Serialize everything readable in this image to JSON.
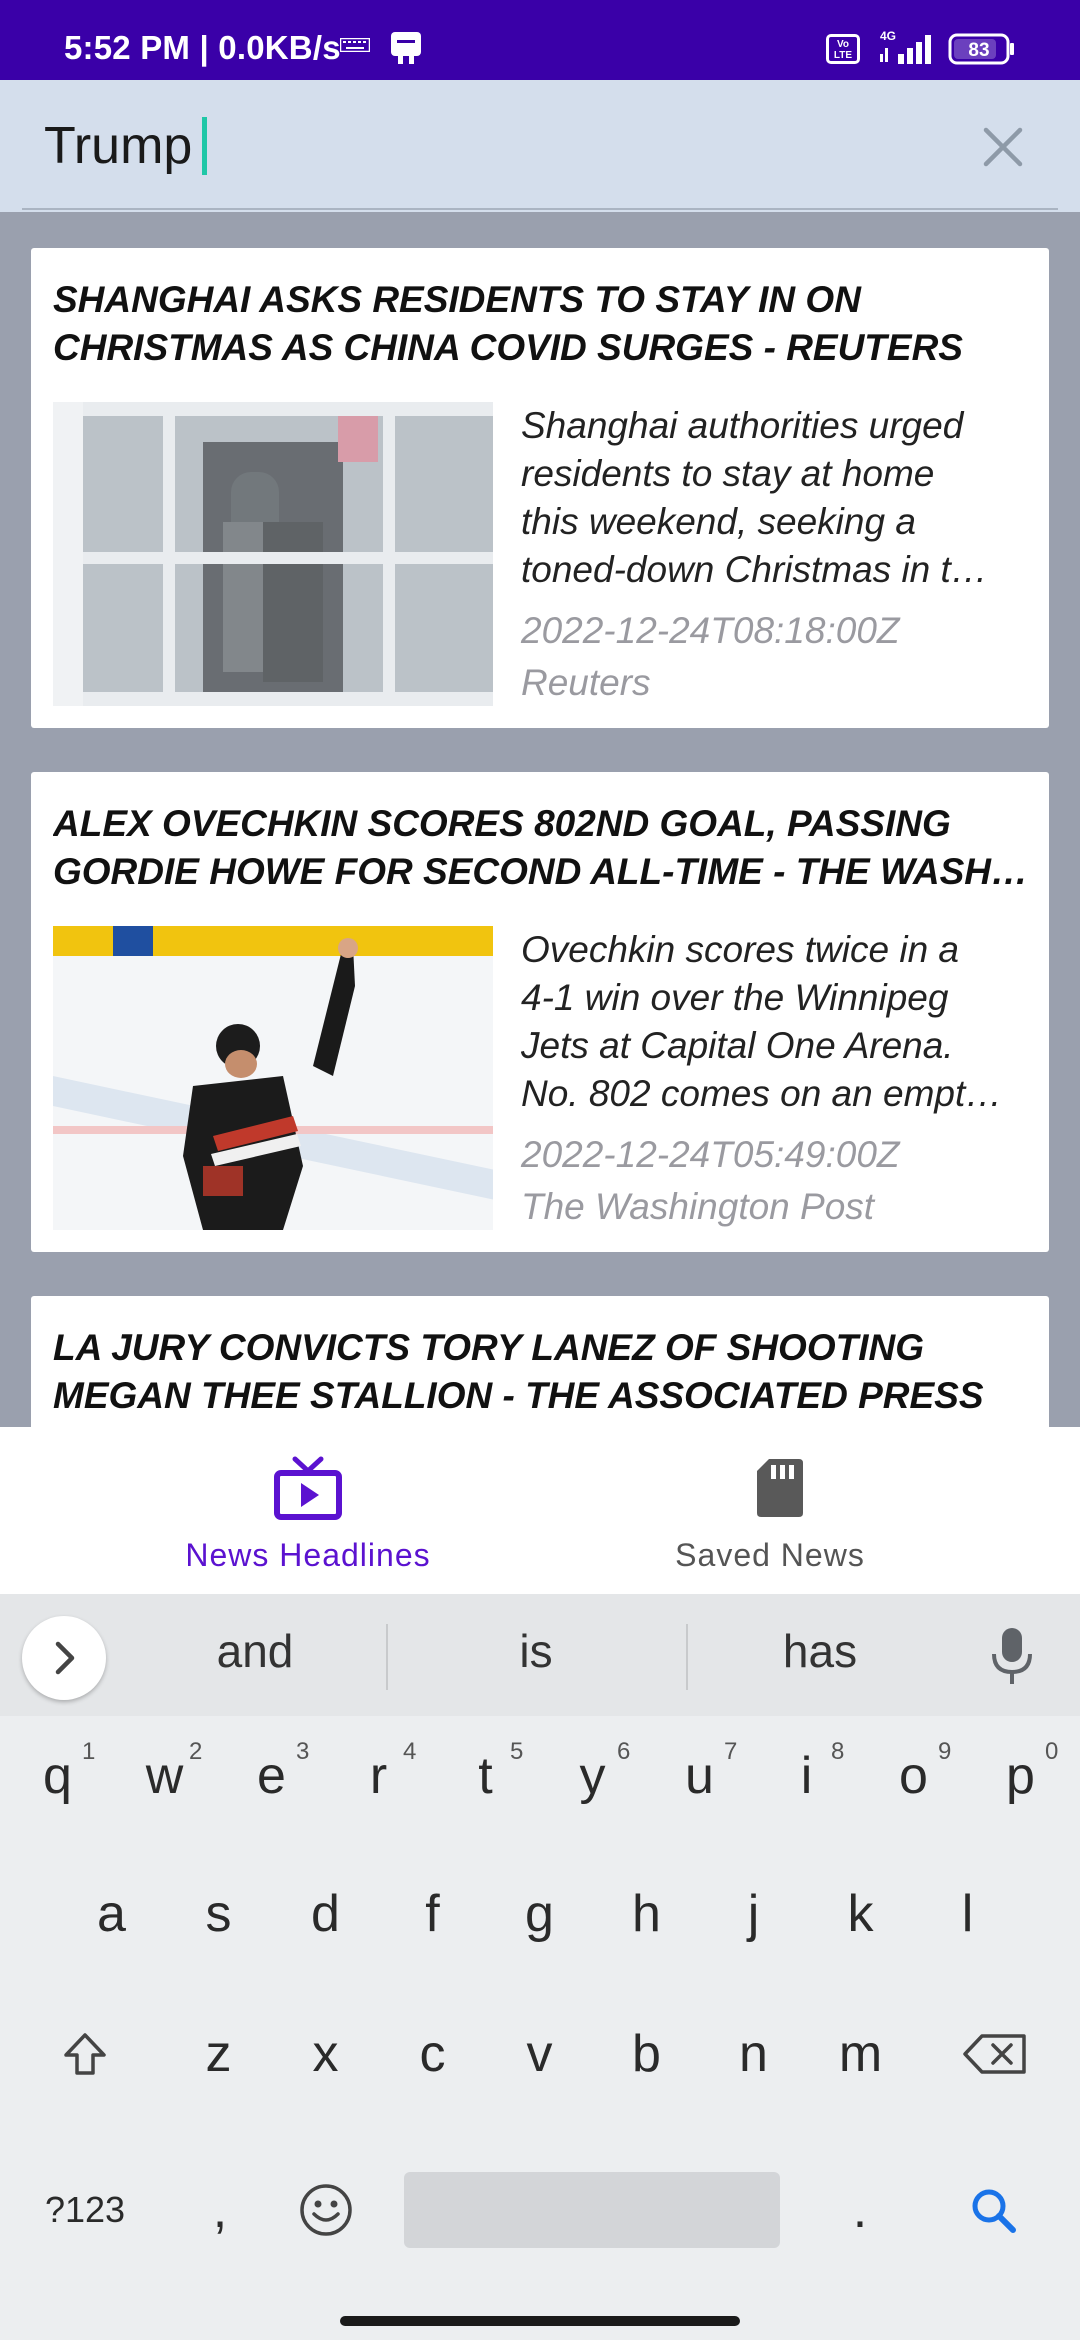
{
  "status_bar": {
    "time": "5:52 PM | 0.0KB/s",
    "network": "4G",
    "volte": "Vo LTE",
    "battery": "83"
  },
  "search": {
    "query": "Trump"
  },
  "cards": [
    {
      "title_lines": [
        "SHANGHAI ASKS RESIDENTS TO STAY IN ON",
        "CHRISTMAS AS CHINA COVID SURGES - REUTERS"
      ],
      "desc_lines": [
        "Shanghai authorities urged",
        "residents to stay at home",
        "this weekend, seeking a",
        "toned-down Christmas in t…"
      ],
      "date": "2022-12-24T08:18:00Z",
      "source": "Reuters"
    },
    {
      "title_lines": [
        "ALEX OVECHKIN SCORES 802ND GOAL, PASSING",
        "GORDIE HOWE FOR SECOND ALL-TIME - THE WASHI…"
      ],
      "desc_lines": [
        "Ovechkin scores twice in a",
        "4-1 win over the Winnipeg",
        "Jets at Capital One Arena.",
        "No. 802 comes on an empt…"
      ],
      "date": "2022-12-24T05:49:00Z",
      "source": "The Washington Post"
    },
    {
      "title_lines": [
        "LA JURY CONVICTS TORY LANEZ OF SHOOTING",
        "MEGAN THEE STALLION - THE ASSOCIATED PRESS"
      ]
    }
  ],
  "bottom_nav": {
    "headlines_label": "News Headlines",
    "saved_label": "Saved News",
    "active_color": "#5b12d0"
  },
  "keyboard": {
    "suggestions": [
      "and",
      "is",
      "has"
    ],
    "row1": [
      "q",
      "w",
      "e",
      "r",
      "t",
      "y",
      "u",
      "i",
      "o",
      "p"
    ],
    "row1_hints": [
      "1",
      "2",
      "3",
      "4",
      "5",
      "6",
      "7",
      "8",
      "9",
      "0"
    ],
    "row2": [
      "a",
      "s",
      "d",
      "f",
      "g",
      "h",
      "j",
      "k",
      "l"
    ],
    "row3": [
      "z",
      "x",
      "c",
      "v",
      "b",
      "n",
      "m"
    ],
    "symbols_label": "?123",
    "comma": ",",
    "period": "."
  },
  "colors": {
    "status_bar": "#3a00a8",
    "search_bg": "#d4deec",
    "caret": "#1fc7a7",
    "search_key": "#1a73e8"
  }
}
